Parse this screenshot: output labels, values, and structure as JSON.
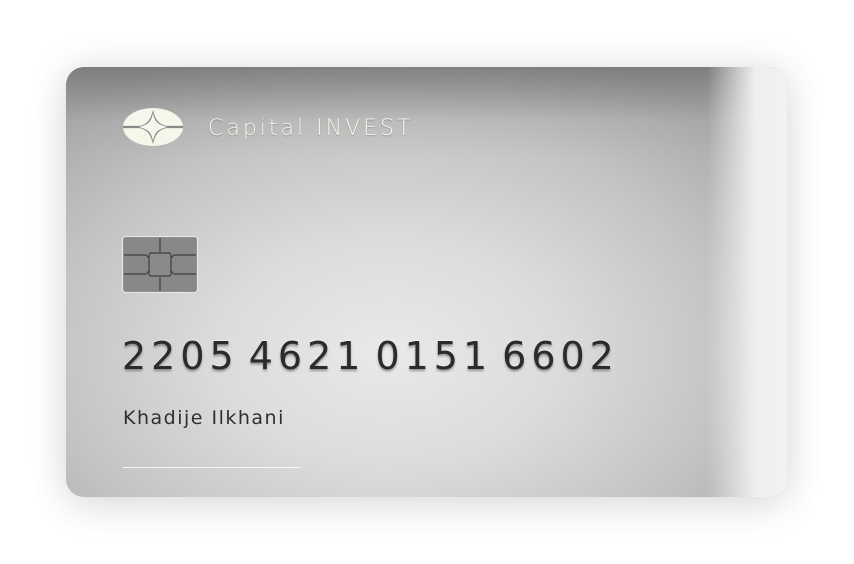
{
  "card": {
    "brand": "Capital INVEST",
    "number_groups": [
      "2205",
      "4621",
      "0151",
      "6602"
    ],
    "holder_name": "Khadije Ilkhani"
  },
  "icons": {
    "logo": "capital-invest-logo-icon",
    "chip": "emv-chip-icon"
  },
  "colors": {
    "brand_text": "#f6f6ea",
    "number_text": "#2b2b2b",
    "card_metal": "#cfcfcf"
  }
}
